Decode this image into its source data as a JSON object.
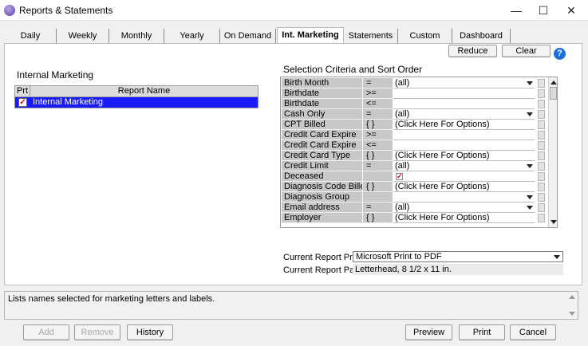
{
  "window": {
    "title": "Reports & Statements",
    "minimize": "—",
    "maximize": "☐",
    "close": "✕"
  },
  "tabs": [
    "Daily",
    "Weekly",
    "Monthly",
    "Yearly",
    "On Demand",
    "Int. Marketing",
    "Statements",
    "Custom",
    "Dashboard"
  ],
  "active_tab": "Int. Marketing",
  "toolbar": {
    "reduce": "Reduce",
    "clear": "Clear",
    "help": "?"
  },
  "report_section": {
    "title": "Internal Marketing",
    "col_prt": "Prt",
    "col_name": "Report Name",
    "rows": [
      {
        "checked": true,
        "name": "Internal Marketing"
      }
    ]
  },
  "criteria": {
    "title": "Selection Criteria and Sort Order",
    "rows": [
      {
        "field": "Birth Month",
        "op": "=",
        "value": "(all)",
        "dropdown": true
      },
      {
        "field": "Birthdate",
        "op": ">=",
        "value": ""
      },
      {
        "field": "Birthdate",
        "op": "<=",
        "value": ""
      },
      {
        "field": "Cash Only",
        "op": "=",
        "value": "(all)",
        "dropdown": true
      },
      {
        "field": "CPT Billed",
        "op": "{ }",
        "value": "(Click Here For Options)"
      },
      {
        "field": "Credit Card Expire",
        "op": ">=",
        "value": ""
      },
      {
        "field": "Credit Card Expire",
        "op": "<=",
        "value": ""
      },
      {
        "field": "Credit Card Type",
        "op": "{ }",
        "value": "(Click Here For Options)"
      },
      {
        "field": "Credit Limit",
        "op": "=",
        "value": "(all)",
        "dropdown": true
      },
      {
        "field": "Deceased",
        "op": "",
        "value": "",
        "checkbox": true
      },
      {
        "field": "Diagnosis Code Billed",
        "op": "{ }",
        "value": "(Click Here For Options)"
      },
      {
        "field": "Diagnosis Group",
        "op": "",
        "value": "",
        "dropdown": true
      },
      {
        "field": "Email address",
        "op": "=",
        "value": "(all)",
        "dropdown": true
      },
      {
        "field": "Employer",
        "op": "{ }",
        "value": "(Click Here For Options)"
      }
    ]
  },
  "printer": {
    "printer_label": "Current Report Printer",
    "printer_value": "Microsoft Print to PDF",
    "paper_label": "Current Report Paper",
    "paper_value": "Letterhead, 8 1/2 x 11 in."
  },
  "description": "Lists names selected for marketing letters and labels.",
  "buttons": {
    "add": "Add",
    "remove": "Remove",
    "history": "History",
    "preview": "Preview",
    "print": "Print",
    "cancel": "Cancel"
  }
}
